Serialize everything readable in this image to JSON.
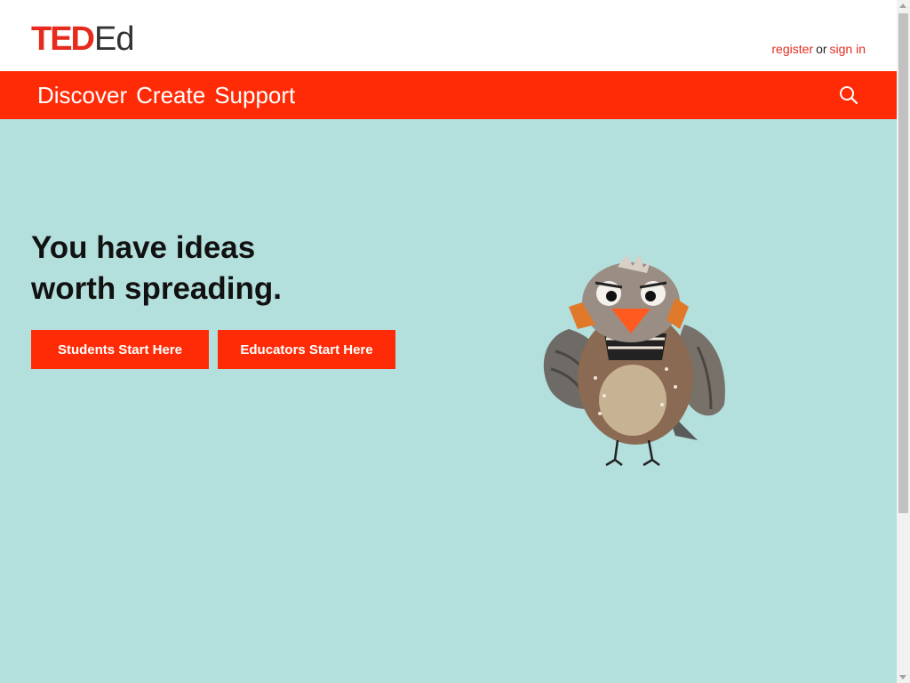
{
  "header": {
    "logo_ted": "TED",
    "logo_ed": "Ed",
    "register": "register",
    "or": "or",
    "sign_in": "sign in"
  },
  "nav": {
    "items": [
      {
        "label": "Discover"
      },
      {
        "label": "Create"
      },
      {
        "label": "Support"
      }
    ],
    "search_icon": "search-icon"
  },
  "hero": {
    "title_line1": "You have ideas",
    "title_line2": "worth spreading.",
    "students_button": "Students Start Here",
    "educators_button": "Educators Start Here"
  },
  "colors": {
    "brand_red": "#ff2b06",
    "logo_red": "#e62b1e",
    "hero_bg": "#b3dfdd"
  }
}
